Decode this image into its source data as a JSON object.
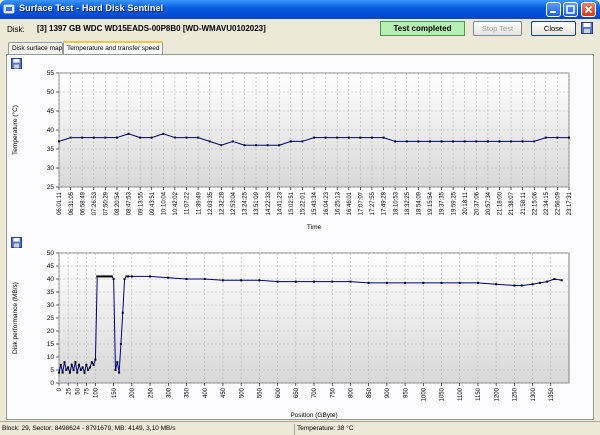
{
  "window": {
    "title": "Surface Test - Hard Disk Sentinel"
  },
  "disk": {
    "label": "Disk:",
    "value": "[3] 1397 GB  WDC WD15EADS-00P8B0 [WD-WMAVU0102023]"
  },
  "status": {
    "text": "Test completed",
    "color": "#b4f0b4"
  },
  "buttons": {
    "stop": "Stop Test",
    "close": "Close"
  },
  "tabs": [
    {
      "label": "Disk surface map",
      "active": false
    },
    {
      "label": "Temperature and transfer speed",
      "active": true
    }
  ],
  "statusbar": {
    "block": "Block: 29, Sector: 8498624 - 8791679, MB: 4149, 3,10 MB/s",
    "temperature": "Temperature: 38 °C"
  },
  "icons": [
    "app-icon",
    "minimize-icon",
    "maximize-icon",
    "close-icon",
    "save-icon"
  ],
  "chart_data": [
    {
      "type": "line",
      "xlabel": "Time",
      "ylabel": "Temperature (°C)",
      "ylim": [
        25,
        55
      ],
      "yticks": [
        25,
        30,
        35,
        40,
        45,
        50,
        55
      ],
      "grid": true,
      "color": "#000080",
      "categories": [
        "06:01:11",
        "06:31:05",
        "06:58:49",
        "07:26:53",
        "07:50:29",
        "08:20:54",
        "08:47:53",
        "09:13:55",
        "09:43:51",
        "10:10:04",
        "10:42:02",
        "11:07:22",
        "11:39:49",
        "12:03:35",
        "12:32:28",
        "12:53:04",
        "13:24:25",
        "13:51:09",
        "14:22:33",
        "14:41:23",
        "15:02:51",
        "15:22:01",
        "15:43:34",
        "16:04:23",
        "16:25:13",
        "16:46:01",
        "17:07:07",
        "17:27:55",
        "17:49:28",
        "18:10:53",
        "18:32:25",
        "18:54:09",
        "19:15:54",
        "19:37:35",
        "19:59:25",
        "20:18:11",
        "20:37:06",
        "20:57:34",
        "21:18:00",
        "21:38:07",
        "21:58:11",
        "22:15:06",
        "22:34:15",
        "22:56:09",
        "23:17:31"
      ],
      "values": [
        37,
        38,
        38,
        38,
        38,
        38,
        39,
        38,
        38,
        39,
        38,
        38,
        38,
        37,
        36,
        37,
        36,
        36,
        36,
        36,
        37,
        37,
        38,
        38,
        38,
        38,
        38,
        38,
        38,
        37,
        37,
        37,
        37,
        37,
        37,
        37,
        37,
        37,
        37,
        37,
        37,
        37,
        38,
        38,
        38
      ]
    },
    {
      "type": "line",
      "xlabel": "Position (GByte)",
      "ylabel": "Disk performance (MB/s)",
      "ylim": [
        0,
        50
      ],
      "yticks": [
        0,
        5,
        10,
        15,
        20,
        25,
        30,
        35,
        40,
        45,
        50
      ],
      "xlim": [
        0,
        1400
      ],
      "xticks": [
        0,
        25,
        50,
        75,
        100,
        150,
        200,
        250,
        300,
        350,
        400,
        450,
        500,
        550,
        600,
        650,
        700,
        750,
        800,
        850,
        900,
        950,
        1000,
        1050,
        1100,
        1150,
        1200,
        1250,
        1300,
        1350
      ],
      "grid": true,
      "color": "#000080",
      "x": [
        0,
        5,
        10,
        15,
        20,
        25,
        30,
        35,
        40,
        45,
        50,
        55,
        60,
        65,
        70,
        75,
        80,
        85,
        90,
        95,
        100,
        105,
        110,
        115,
        120,
        125,
        130,
        135,
        140,
        145,
        150,
        155,
        160,
        165,
        170,
        175,
        180,
        185,
        190,
        200,
        250,
        300,
        350,
        400,
        450,
        500,
        550,
        600,
        650,
        700,
        750,
        800,
        850,
        900,
        950,
        1000,
        1050,
        1100,
        1150,
        1200,
        1250,
        1270,
        1300,
        1320,
        1340,
        1360,
        1380
      ],
      "values": [
        4,
        7,
        4,
        8,
        5,
        6,
        4,
        7,
        5,
        8,
        4,
        7,
        5,
        6,
        4,
        7,
        5,
        6,
        8,
        7,
        9,
        41,
        41,
        41,
        41,
        41,
        41,
        41,
        41,
        41,
        40,
        5,
        8,
        4,
        15,
        27,
        40,
        41,
        41,
        41,
        41,
        40.5,
        40,
        40,
        39.5,
        39.5,
        39.5,
        39,
        39,
        39,
        39,
        39,
        38.5,
        38.5,
        38.5,
        38.5,
        38.5,
        38.5,
        38.5,
        38,
        37.5,
        37.5,
        38,
        38.5,
        39,
        40,
        39.5
      ]
    }
  ]
}
